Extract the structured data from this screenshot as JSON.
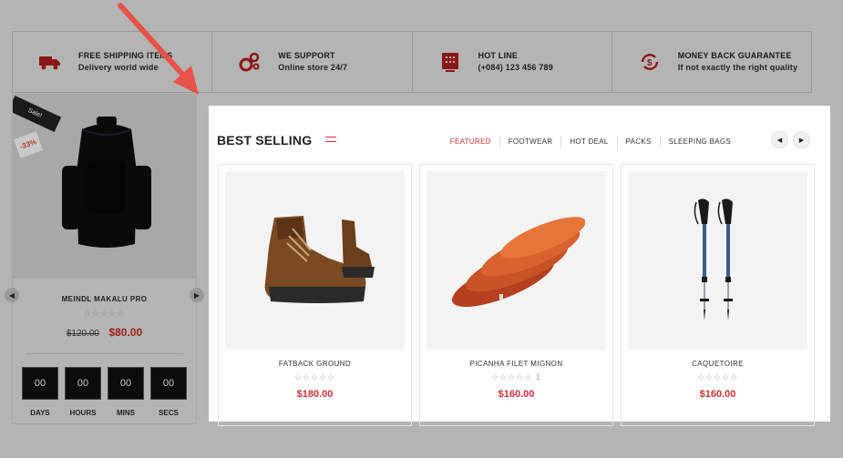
{
  "features": [
    {
      "icon": "truck-icon",
      "title": "FREE SHIPPING ITEMS",
      "subtitle": "Delivery world wide"
    },
    {
      "icon": "gears-icon",
      "title": "WE SUPPORT",
      "subtitle": "Online store 24/7"
    },
    {
      "icon": "phone-icon",
      "title": "HOT LINE",
      "subtitle": "(+084) 123 456 789"
    },
    {
      "icon": "money-back-icon",
      "title": "MONEY BACK GUARANTEE",
      "subtitle": "If not exactly the right quality"
    }
  ],
  "deal": {
    "ribbon": "Sale!",
    "discount": "-33%",
    "name": "MEINDL MAKALU PRO",
    "stars": "☆☆☆☆☆",
    "old_price": "$120.00",
    "new_price": "$80.00",
    "countdown": [
      {
        "value": "00",
        "label": "DAYS"
      },
      {
        "value": "00",
        "label": "HOURS"
      },
      {
        "value": "00",
        "label": "MINS"
      },
      {
        "value": "00",
        "label": "SECS"
      }
    ]
  },
  "best_selling": {
    "title": "BEST SELLING",
    "tabs": [
      "FEATURED",
      "FOOTWEAR",
      "HOT DEAL",
      "PACKS",
      "SLEEPING BAGS"
    ],
    "active_tab": "FEATURED",
    "products": [
      {
        "name": "FATBACK GROUND",
        "stars": "☆☆☆☆☆",
        "price": "$180.00",
        "image": "hiking-boot"
      },
      {
        "name": "PICANHA FILET MIGNON",
        "stars": "☆☆☆☆☆ 1",
        "price": "$160.00",
        "image": "sleeping-pads"
      },
      {
        "name": "CAQUETOIRE",
        "stars": "☆☆☆☆☆",
        "price": "$160.00",
        "image": "trekking-poles"
      }
    ]
  },
  "colors": {
    "accent": "#d0323a",
    "overlay": "#b4b4b4",
    "arrow": "#e8524a"
  }
}
